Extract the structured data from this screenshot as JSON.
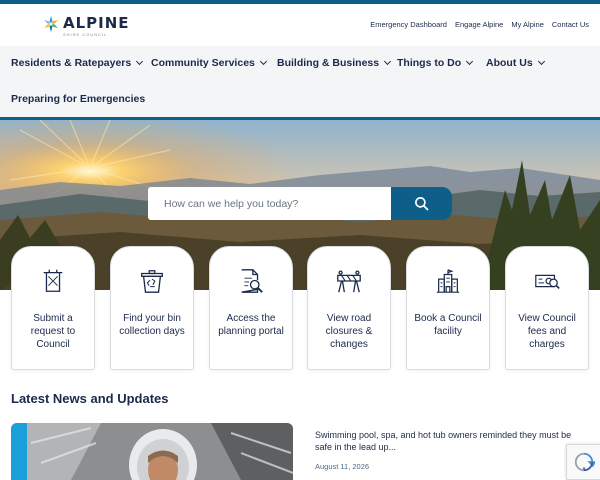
{
  "logo": {
    "name": "ALPINE",
    "tagline": "SHIRE COUNCIL",
    "icon": "snowflake-star-icon"
  },
  "utility_nav": [
    {
      "label": "Emergency Dashboard"
    },
    {
      "label": "Engage Alpine"
    },
    {
      "label": "My Alpine"
    },
    {
      "label": "Contact Us"
    }
  ],
  "main_nav": [
    {
      "label": "Residents & Ratepayers",
      "has_dropdown": true
    },
    {
      "label": "Community Services",
      "has_dropdown": true
    },
    {
      "label": "Building & Business",
      "has_dropdown": true
    },
    {
      "label": "Things to Do",
      "has_dropdown": true
    },
    {
      "label": "About Us",
      "has_dropdown": true
    },
    {
      "label": "Preparing for Emergencies",
      "has_dropdown": false
    }
  ],
  "search": {
    "placeholder": "How can we help you today?",
    "button_icon": "search-icon"
  },
  "quick_links": [
    {
      "label": "Submit a request to Council",
      "icon": "request-form-icon"
    },
    {
      "label": "Find your bin collection days",
      "icon": "recycle-bin-icon"
    },
    {
      "label": "Access the planning portal",
      "icon": "document-search-icon"
    },
    {
      "label": "View road closures & changes",
      "icon": "road-barrier-icon"
    },
    {
      "label": "Book a Council facility",
      "icon": "building-icon"
    },
    {
      "label": "View Council fees and charges",
      "icon": "fees-card-icon"
    }
  ],
  "news": {
    "section_title": "Latest News and Updates",
    "items": [
      {
        "headline": "Swimming pool, spa, and hot tub owners reminded they must be safe in the lead up...",
        "date": "August 11, 2026"
      }
    ]
  },
  "colors": {
    "brand": "#0d5f8a",
    "text": "#1b2a4a",
    "nav_bg": "#f4f5f7",
    "news_accent": "#1aa0d8"
  }
}
